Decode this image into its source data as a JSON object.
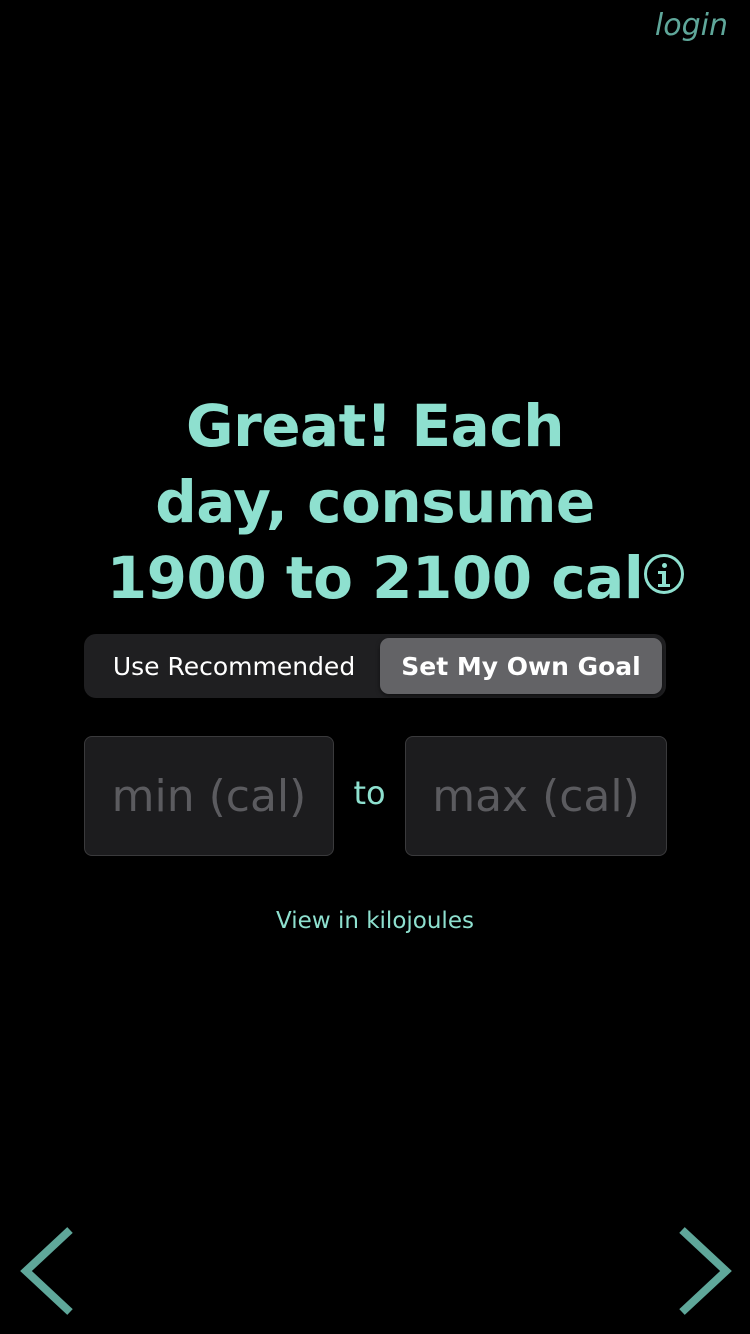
{
  "header": {
    "login_label": "login"
  },
  "headline": {
    "line1": "Great! Each",
    "line2": "day, consume",
    "line3": "1900 to 2100 cal"
  },
  "goal_toggle": {
    "options": [
      "Use Recommended",
      "Set My Own Goal"
    ],
    "selected": "Set My Own Goal"
  },
  "range_inputs": {
    "min_placeholder": "min (cal)",
    "min_value": "",
    "separator": "to",
    "max_placeholder": "max (cal)",
    "max_value": ""
  },
  "units_link": "View in kilojoules",
  "icons": {
    "info": "info-icon",
    "back": "chevron-left-icon",
    "forward": "chevron-right-icon"
  },
  "colors": {
    "accent": "#8ee0cf",
    "login": "#5fa79a",
    "nav_arrow": "#5fa79a",
    "background": "#000000",
    "segment_active": "#636366",
    "segment_track": "#1f1f21"
  }
}
